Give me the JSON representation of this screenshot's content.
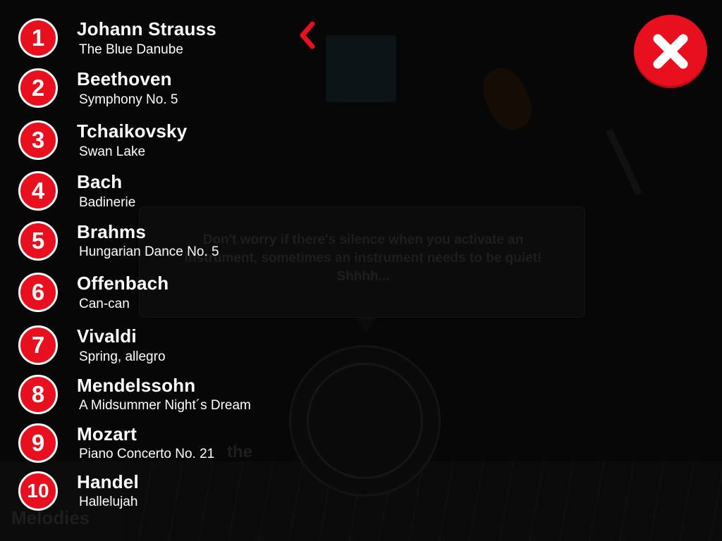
{
  "background": {
    "tooltip_text": "Don't worry if there's silence when you activate an instrument, sometimes an instrument needs to be quiet! Shhhh...",
    "melodies_label": "Melodies",
    "the_label": "the"
  },
  "melodies": [
    {
      "number": "1",
      "composer": "Johann Strauss",
      "piece": "The Blue Danube"
    },
    {
      "number": "2",
      "composer": "Beethoven",
      "piece": "Symphony No. 5"
    },
    {
      "number": "3",
      "composer": "Tchaikovsky",
      "piece": "Swan Lake"
    },
    {
      "number": "4",
      "composer": "Bach",
      "piece": "Badinerie"
    },
    {
      "number": "5",
      "composer": "Brahms",
      "piece": "Hungarian Dance No. 5"
    },
    {
      "number": "6",
      "composer": "Offenbach",
      "piece": "Can-can"
    },
    {
      "number": "7",
      "composer": "Vivaldi",
      "piece": "Spring, allegro"
    },
    {
      "number": "8",
      "composer": "Mendelssohn",
      "piece": "A Midsummer Night´s Dream"
    },
    {
      "number": "9",
      "composer": "Mozart",
      "piece": "Piano Concerto No. 21"
    },
    {
      "number": "10",
      "composer": "Handel",
      "piece": "Hallelujah"
    }
  ],
  "icons": {
    "back": "chevron-left-icon",
    "close": "close-icon"
  },
  "colors": {
    "accent": "#e8101e",
    "background": "#000000",
    "text": "#ffffff"
  }
}
